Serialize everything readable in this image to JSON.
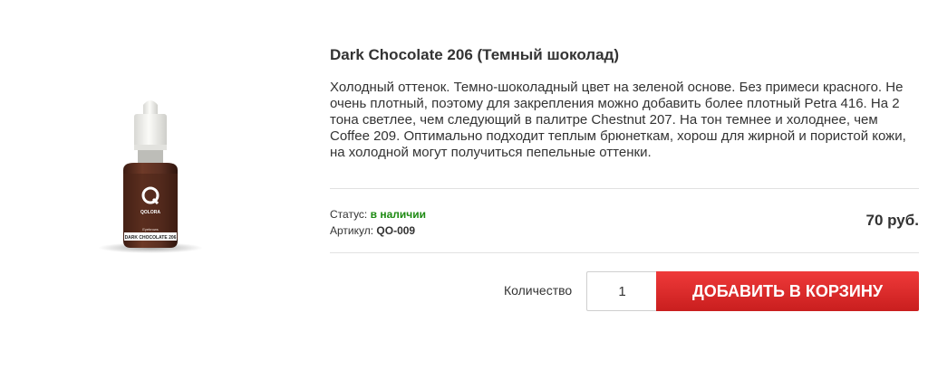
{
  "product": {
    "title": "Dark Chocolate 206 (Темный шоколад)",
    "description": "Холодный оттенок. Темно-шоколадный цвет на зеленой основе. Без примеси красного. Не очень плотный, поэтому для закрепления можно добавить более плотный Petra 416. На 2 тона светлее, чем следующий в палитре Chestnut 207. На тон темнее и холоднее, чем Coffee 209. Оптимально подходит теплым брюнеткам, хорош для жирной и пористой кожи, на холодной могут получиться пепельные оттенки.",
    "bottle_label": {
      "brand": "QOLORA",
      "line": "Eyebrows",
      "name": "DARK CHOCOLATE 206"
    }
  },
  "meta": {
    "status_label": "Статус: ",
    "status_value": "в наличии",
    "sku_label": "Артикул: ",
    "sku_value": "QO-009"
  },
  "price": "70 руб.",
  "cart": {
    "quantity_label": "Количество",
    "quantity_value": "1",
    "add_button_label": "ДОБАВИТЬ В КОРЗИНУ"
  },
  "colors": {
    "status_green": "#1d8a12",
    "button_red": "#e02b2b",
    "bottle_brown": "#5a2f22"
  }
}
